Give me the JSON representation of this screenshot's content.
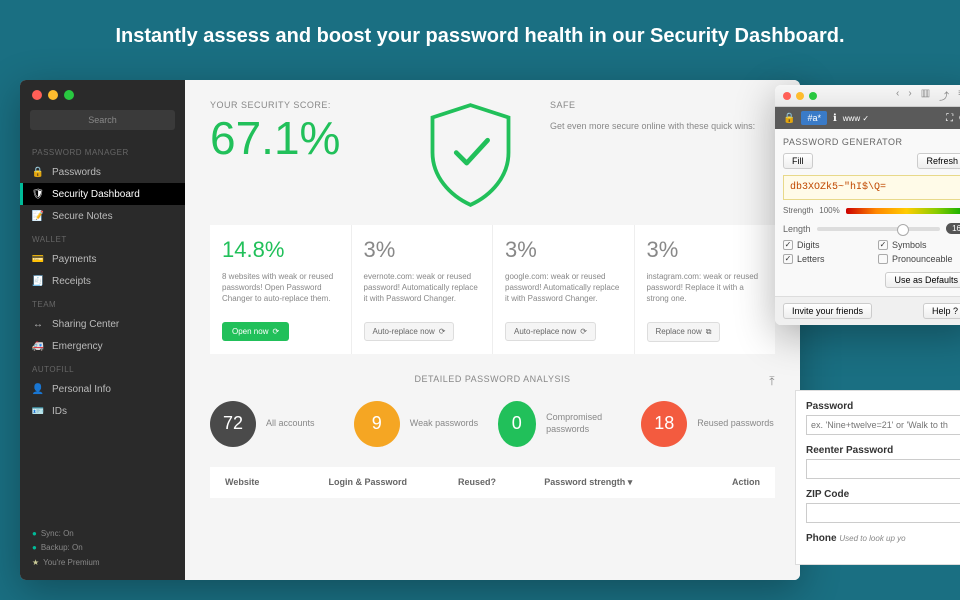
{
  "headline": "Instantly assess and boost your password health in our Security Dashboard.",
  "sidebar": {
    "search_placeholder": "Search",
    "sections": [
      {
        "title": "PASSWORD MANAGER",
        "items": [
          {
            "label": "Passwords",
            "icon": "🔒"
          },
          {
            "label": "Security Dashboard",
            "icon": "🛡"
          },
          {
            "label": "Secure Notes",
            "icon": "📝"
          }
        ]
      },
      {
        "title": "WALLET",
        "items": [
          {
            "label": "Payments",
            "icon": "💳"
          },
          {
            "label": "Receipts",
            "icon": "🧾"
          }
        ]
      },
      {
        "title": "TEAM",
        "items": [
          {
            "label": "Sharing Center",
            "icon": "↔"
          },
          {
            "label": "Emergency",
            "icon": "🚑"
          }
        ]
      },
      {
        "title": "AUTOFILL",
        "items": [
          {
            "label": "Personal Info",
            "icon": "👤"
          },
          {
            "label": "IDs",
            "icon": "🪪"
          }
        ]
      }
    ],
    "status": {
      "sync": "Sync: On",
      "backup": "Backup: On",
      "premium": "You're Premium"
    }
  },
  "score": {
    "label": "YOUR SECURITY SCORE:",
    "value": "67.1%",
    "safe_label": "SAFE",
    "safe_text": "Get even more secure online with these quick wins:"
  },
  "cards": [
    {
      "pct": "14.8%",
      "green": true,
      "desc": "8 websites with weak or reused passwords! Open Password Changer to auto-replace them.",
      "btn": "Open now",
      "solid": true
    },
    {
      "pct": "3%",
      "desc": "evernote.com: weak or reused password! Automatically replace it with Password Changer.",
      "btn": "Auto-replace now"
    },
    {
      "pct": "3%",
      "desc": "google.com: weak or reused password! Automatically replace it with Password Changer.",
      "btn": "Auto-replace now"
    },
    {
      "pct": "3%",
      "desc": "instagram.com: weak or reused password! Replace it with a strong one.",
      "btn": "Replace now"
    }
  ],
  "analysis": {
    "title": "DETAILED PASSWORD ANALYSIS",
    "stats": [
      {
        "n": "72",
        "label": "All accounts",
        "color": "c-dark"
      },
      {
        "n": "9",
        "label": "Weak passwords",
        "color": "c-orange"
      },
      {
        "n": "0",
        "label": "Compromised passwords",
        "color": "c-green"
      },
      {
        "n": "18",
        "label": "Reused passwords",
        "color": "c-red"
      }
    ],
    "columns": [
      "Website",
      "Login & Password",
      "Reused?",
      "Password strength ▾",
      "Action"
    ]
  },
  "generator": {
    "title": "PASSWORD GENERATOR",
    "fill": "Fill",
    "refresh": "Refresh",
    "password": "db3XOZk5~\"hI$\\Q=",
    "strength_label": "Strength",
    "strength_pct": "100%",
    "length_label": "Length",
    "length_value": "16",
    "options": {
      "digits": {
        "label": "Digits",
        "checked": true
      },
      "symbols": {
        "label": "Symbols",
        "checked": true
      },
      "letters": {
        "label": "Letters",
        "checked": true
      },
      "pronounceable": {
        "label": "Pronounceable",
        "checked": false
      }
    },
    "use_defaults": "Use as Defaults",
    "invite": "Invite your friends",
    "help": "Help"
  },
  "form_peek": {
    "password_label": "Password",
    "password_hint": "ex. 'Nine+twelve=21' or 'Walk to th",
    "reenter_label": "Reenter Password",
    "zip_label": "ZIP Code",
    "phone_label": "Phone",
    "phone_hint": "Used to look up yo"
  }
}
